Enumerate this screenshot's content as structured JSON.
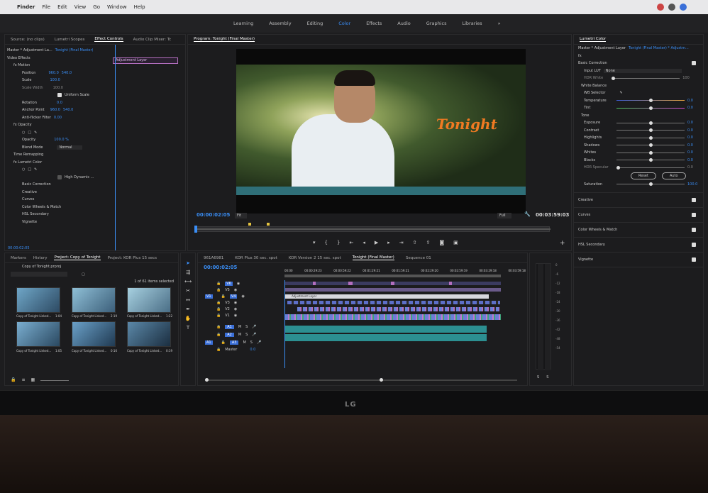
{
  "macbar": {
    "apple": "",
    "app": "Finder",
    "menus": [
      "File",
      "Edit",
      "View",
      "Go",
      "Window",
      "Help"
    ]
  },
  "workspaces": [
    "Learning",
    "Assembly",
    "Editing",
    "Color",
    "Effects",
    "Audio",
    "Graphics",
    "Libraries"
  ],
  "active_workspace": "Color",
  "source_panel": {
    "tabs": [
      "Source: (no clips)",
      "Lumetri Scopes",
      "Effect Controls",
      "Audio Clip Mixer: Tc"
    ],
    "active_tab": "Effect Controls",
    "clip_path": "Master * Adjustment La...",
    "sequence": "Tonight (Final Master)",
    "clip_label": "Adjustment Layer",
    "video_effects": "Video Effects",
    "rows": [
      {
        "label": "fx  Motion"
      },
      {
        "label": "Position",
        "v1": "960.0",
        "v2": "540.0"
      },
      {
        "label": "Scale",
        "v1": "100.0"
      },
      {
        "label": "Scale Width",
        "v1": "100.0"
      },
      {
        "label": "Uniform Scale"
      },
      {
        "label": "Rotation",
        "v1": "0.0"
      },
      {
        "label": "Anchor Point",
        "v1": "960.0",
        "v2": "540.0"
      },
      {
        "label": "Anti-flicker Filter",
        "v1": "0.00"
      },
      {
        "label": "fx  Opacity"
      },
      {
        "label": "Opacity",
        "v1": "100.0 %"
      },
      {
        "label": "Blend Mode",
        "v1": "Normal"
      },
      {
        "label": "Time Remapping"
      },
      {
        "label": "fx  Lumetri Color"
      },
      {
        "label": "High Dynamic ..."
      },
      {
        "label": "Basic Correction"
      },
      {
        "label": "Creative"
      },
      {
        "label": "Curves"
      },
      {
        "label": "Color Wheels & Match"
      },
      {
        "label": "HSL Secondary"
      },
      {
        "label": "Vignette"
      }
    ],
    "timecode": "00:00:02:05"
  },
  "program": {
    "title": "Program: Tonight (Final Master)",
    "overlay_text": "Tonight",
    "timecode_left": "00:00:02:05",
    "fit": "Fit",
    "quality": "Full",
    "timecode_right": "00:03:59:03"
  },
  "lumetri": {
    "title": "Lumetri Color",
    "path": "Master * Adjustment Layer",
    "seq": "Tonight (Final Master) * Adjustm...",
    "basic_correction": "Basic Correction",
    "input_lut_label": "Input LUT",
    "input_lut_value": "None",
    "hdr_white_label": "HDR White",
    "hdr_white_value": "100",
    "white_balance": "White Balance",
    "wb_selector": "WB Selector",
    "wb": [
      {
        "label": "Temperature",
        "value": "0.0"
      },
      {
        "label": "Tint",
        "value": "0.0"
      }
    ],
    "tone": "Tone",
    "tone_rows": [
      {
        "label": "Exposure",
        "value": "0.0"
      },
      {
        "label": "Contrast",
        "value": "0.0"
      },
      {
        "label": "Highlights",
        "value": "0.0"
      },
      {
        "label": "Shadows",
        "value": "0.0"
      },
      {
        "label": "Whites",
        "value": "0.0"
      },
      {
        "label": "Blacks",
        "value": "0.0"
      },
      {
        "label": "HDR Specular",
        "value": "0.0"
      }
    ],
    "reset": "Reset",
    "auto": "Auto",
    "saturation_label": "Saturation",
    "saturation_value": "100.0",
    "sections": [
      "Creative",
      "Curves",
      "Color Wheels & Match",
      "HSL Secondary",
      "Vignette"
    ]
  },
  "project": {
    "tabs": [
      "Markers",
      "History",
      "Project: Copy of Tonight",
      "Project: KOR Plus 15 secs"
    ],
    "active_tab": "Project: Copy of Tonight",
    "file": "Copy of Tonight.prproj",
    "count": "1 of 61 items selected",
    "items": [
      {
        "name": "Copy of Tonight Linked...",
        "dur": "1:04"
      },
      {
        "name": "Copy of Tonight Linked...",
        "dur": "2:19"
      },
      {
        "name": "Copy of Tonight Linked...",
        "dur": "1:22"
      },
      {
        "name": "Copy of Tonight Linked...",
        "dur": "1:05"
      },
      {
        "name": "Copy of Tonight Linked...",
        "dur": "0:16"
      },
      {
        "name": "Copy of Tonight Linked...",
        "dur": "0:19"
      }
    ]
  },
  "timeline": {
    "tabs": [
      "961A6981",
      "KOR Plus 30 sec. spot",
      "KOR Version 2 15 sec. spot",
      "Tonight (Final Master)",
      "Sequence 01"
    ],
    "active_tab": "Tonight (Final Master)",
    "timecode": "00:00:02:05",
    "ruler": [
      "00:00",
      "00:00:29:23",
      "00:00:59:22",
      "00:01:29:21",
      "00:01:59:21",
      "00:02:29:20",
      "00:02:59:19",
      "00:03:29:18",
      "00:03:59:18"
    ],
    "video_tracks": [
      "V6",
      "V5",
      "V4",
      "V3",
      "V2",
      "V1"
    ],
    "audio_tracks": [
      "A1",
      "A2",
      "A3"
    ],
    "master": "Master",
    "master_value": "0.0",
    "adjustment_label": "Adjustment Layer"
  },
  "meter": {
    "ticks": [
      "0",
      "-6",
      "-12",
      "-18",
      "-24",
      "-30",
      "-36",
      "-42",
      "-48",
      "-54"
    ],
    "solo": [
      "S",
      "S"
    ]
  }
}
